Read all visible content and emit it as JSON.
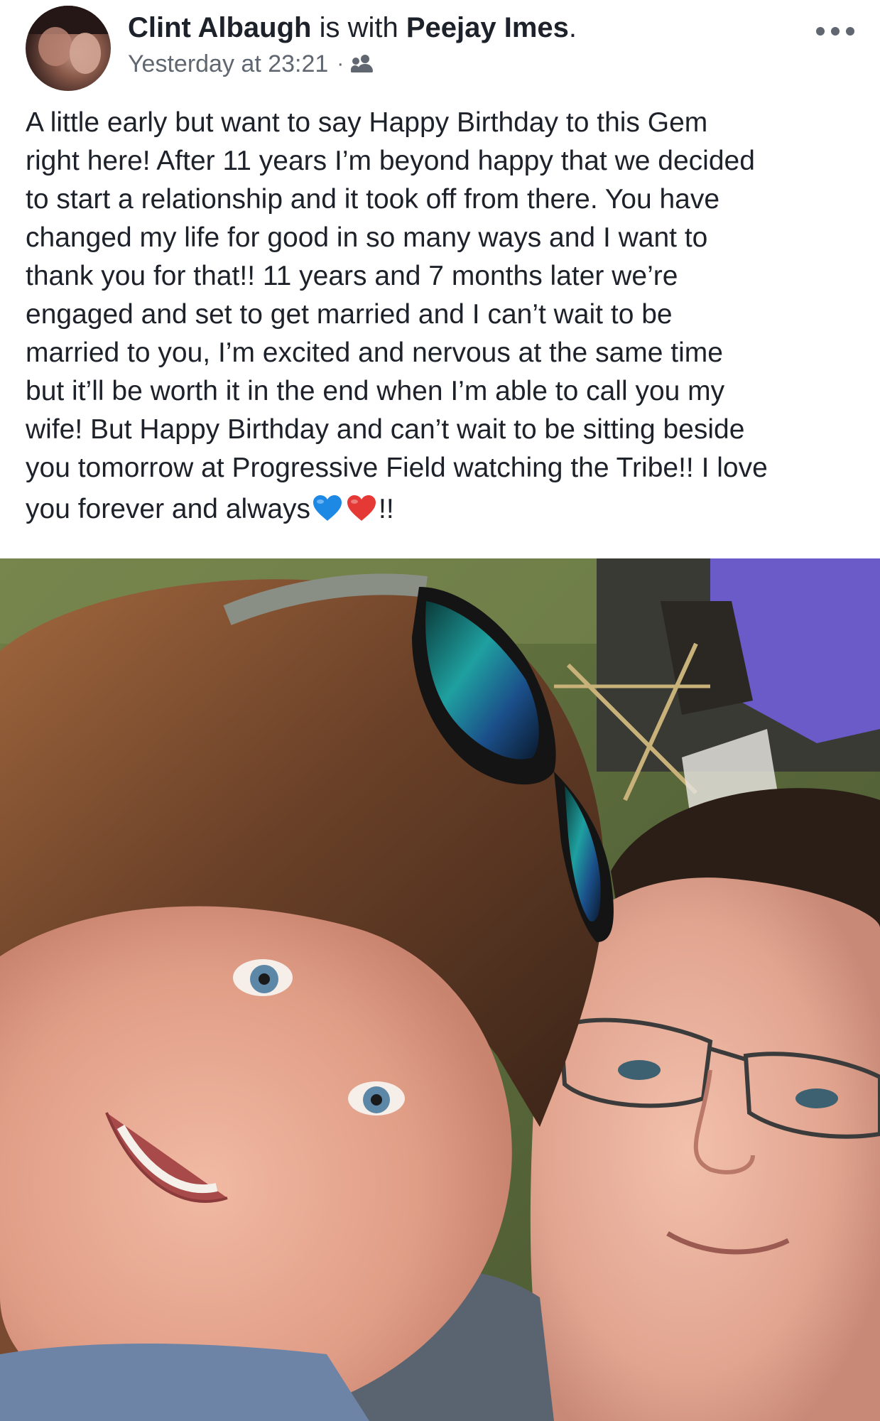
{
  "post": {
    "author": "Clint Albaugh",
    "with_text": " is with ",
    "tagged": "Peejay Imes",
    "period": ".",
    "timestamp": "Yesterday at 23:21",
    "separator": "·",
    "privacy_icon": "friends-icon",
    "more_icon": "more-options-icon",
    "text_lines": [
      "A little early but want to say Happy Birthday to this Gem",
      "right here! After 11 years I’m beyond happy that we decided",
      "to start a relationship and it took off from there. You have",
      "changed my life for good in so many ways and I want to",
      "thank you for that!! 11 years and 7 months later we’re",
      "engaged and set to get married and I can’t wait to be",
      "married to you, I’m excited and nervous at the same time",
      "but it’ll be worth it in the end when I’m able to call you my",
      "wife! But Happy Birthday and can’t wait to be sitting beside",
      "you tomorrow at Progressive Field watching the Tribe!! I love"
    ],
    "last_line_prefix": "you forever and always",
    "last_line_suffix": "!!",
    "emojis": [
      "blue-heart",
      "red-heart"
    ],
    "colors": {
      "text": "#1d2129",
      "meta": "#606770",
      "blue_heart": "#1e88e5",
      "red_heart": "#e53935"
    }
  }
}
